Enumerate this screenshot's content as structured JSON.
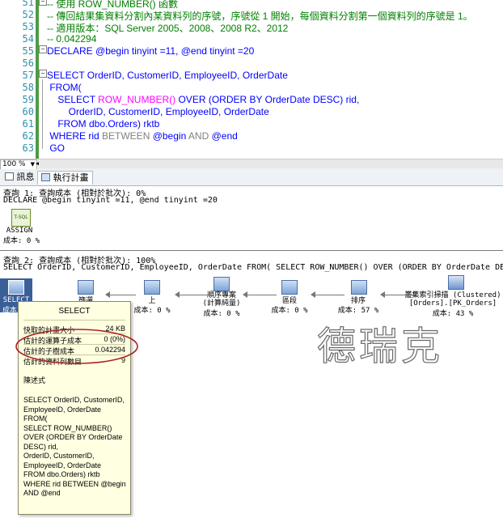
{
  "editor": {
    "lines": [
      {
        "num": "51",
        "parts": [
          {
            "t": "-- 使用 ROW_NUMBER() 函數",
            "c": "cm"
          }
        ]
      },
      {
        "num": "52",
        "parts": [
          {
            "t": "-- 傳回結果集資料分割內某資料列的序號，序號從 1 開始，每個資料分割第一個資料列的序號是 1。",
            "c": "cm"
          }
        ]
      },
      {
        "num": "53",
        "parts": [
          {
            "t": "-- 適用版本：SQL Server 2005、2008、2008 R2、2012",
            "c": "cm"
          }
        ]
      },
      {
        "num": "54",
        "parts": [
          {
            "t": "-- 0.042294",
            "c": "cm"
          }
        ]
      },
      {
        "num": "55",
        "parts": [
          {
            "t": "DECLARE @begin tinyint =11, @end tinyint =20",
            "c": "kw"
          }
        ]
      },
      {
        "num": "56",
        "parts": [
          {
            "t": "",
            "c": ""
          }
        ]
      },
      {
        "num": "57",
        "parts": [
          {
            "t": "SELECT OrderID, CustomerID, EmployeeID, OrderDate",
            "c": "kw"
          }
        ]
      },
      {
        "num": "58",
        "parts": [
          {
            "t": " FROM(",
            "c": "kw"
          }
        ]
      },
      {
        "num": "59",
        "parts": [
          {
            "t": "    SELECT ",
            "c": "kw"
          },
          {
            "t": "ROW_NUMBER()",
            "c": "fn"
          },
          {
            "t": " OVER (ORDER BY OrderDate DESC) rid,",
            "c": "kw"
          }
        ]
      },
      {
        "num": "60",
        "parts": [
          {
            "t": "        OrderID, CustomerID, EmployeeID, OrderDate",
            "c": "kw"
          }
        ]
      },
      {
        "num": "61",
        "parts": [
          {
            "t": "    FROM dbo.Orders) rktb",
            "c": "kw"
          }
        ]
      },
      {
        "num": "62",
        "parts": [
          {
            "t": " WHERE rid ",
            "c": "kw"
          },
          {
            "t": "BETWEEN",
            "c": "gr"
          },
          {
            "t": " @begin ",
            "c": "kw"
          },
          {
            "t": "AND",
            "c": "gr"
          },
          {
            "t": " @end",
            "c": "kw"
          }
        ]
      },
      {
        "num": "63",
        "parts": [
          {
            "t": " GO",
            "c": "kw"
          }
        ]
      }
    ]
  },
  "status": {
    "zoom": "100 %"
  },
  "tabs": {
    "messages": "訊息",
    "plan": "執行計畫"
  },
  "query1": {
    "header": "查詢 1: 查詢成本 (相對於批次): 0%",
    "sql": "DECLARE @begin tinyint =11, @end tinyint =20",
    "node_icon_text": "T-SQL",
    "node_name": "ASSIGN",
    "node_cost": "成本: 0 %"
  },
  "query2": {
    "header": "查詢 2: 查詢成本 (相對於批次): 100%",
    "sql": "SELECT OrderID, CustomerID, EmployeeID, OrderDate FROM( SELECT ROW_NUMBER() OVER (ORDER BY OrderDate DESC",
    "nodes": {
      "select": {
        "name": "SELECT",
        "cost": "成本: 0"
      },
      "filter": {
        "name": "篩選",
        "cost": ""
      },
      "top": {
        "name": "上",
        "cost": "成本: 0 %"
      },
      "sequence": {
        "name": "順序專案\n(計算純量)",
        "cost": "成本: 0 %"
      },
      "segment": {
        "name": "區段",
        "cost": "成本: 0 %"
      },
      "sort": {
        "name": "排序",
        "cost": "成本: 57 %"
      },
      "scan": {
        "name": "叢集索引掃描 (Clustered)\n[Orders].[PK_Orders]",
        "cost": "成本: 43 %"
      }
    }
  },
  "tooltip": {
    "title": "SELECT",
    "rows": [
      {
        "label": "快取的計畫大小",
        "value": "24 KB"
      },
      {
        "label": "估計的運算子成本",
        "value": "0 (0%)"
      },
      {
        "label": "估計的子樹成本",
        "value": "0.042294"
      },
      {
        "label": "估計的資料列數目",
        "value": "9"
      }
    ],
    "stmt_label": "陳述式",
    "stmt_lines": [
      "SELECT OrderID, CustomerID,",
      "EmployeeID, OrderDate",
      "FROM(",
      "SELECT ROW_NUMBER()",
      "OVER (ORDER BY OrderDate",
      "DESC) rid,",
      "OrderID, CustomerID,",
      "EmployeeID, OrderDate",
      "FROM dbo.Orders) rktb",
      "WHERE rid BETWEEN @begin",
      "AND @end"
    ]
  },
  "watermark": "德瑞克",
  "colors": {
    "highlight_ellipse": "#b02020",
    "scrollbar_bg": "#e8e8e8"
  }
}
